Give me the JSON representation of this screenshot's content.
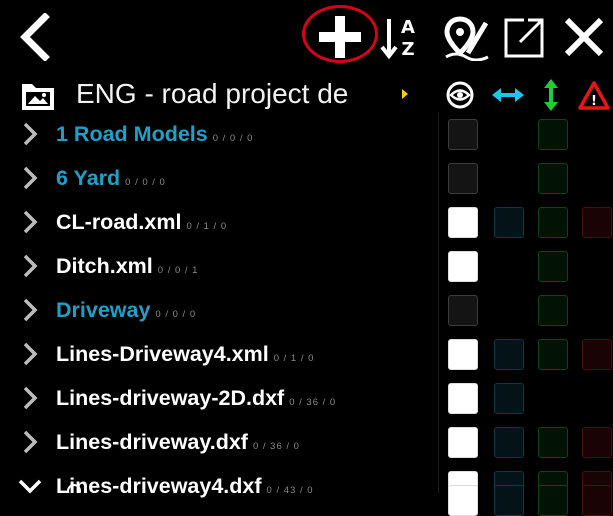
{
  "toolbar": {
    "back": "back-icon",
    "add": "plus-icon",
    "sort": "sort-az-icon",
    "map_edit": "map-pin-edit-icon",
    "open_external": "external-window-icon",
    "close": "close-icon",
    "highlight_color": "#d8001a"
  },
  "project": {
    "icon": "image-folder-icon",
    "title": "ENG - road project de"
  },
  "columns": {
    "visibility": "eye-icon",
    "horizontal": "horizontal-arrows-icon",
    "vertical": "vertical-arrows-icon",
    "warning": "warning-icon",
    "warning_text": "!",
    "cyan": "#18c6ee",
    "green": "#21cc36",
    "red": "#e8141a"
  },
  "rows": [
    {
      "label": "1 Road Models",
      "counts": "0 / 0 / 0",
      "color": "blue",
      "expanded": false,
      "checks": [
        "off",
        "none",
        "green",
        "none"
      ]
    },
    {
      "label": "6 Yard",
      "counts": "0 / 0 / 0",
      "color": "blue",
      "expanded": false,
      "checks": [
        "off",
        "none",
        "green",
        "none"
      ]
    },
    {
      "label": "CL-road.xml",
      "counts": "0 / 1 / 0",
      "color": "white",
      "expanded": false,
      "checks": [
        "on",
        "cyan",
        "green",
        "red"
      ]
    },
    {
      "label": "Ditch.xml",
      "counts": "0 / 0 / 1",
      "color": "white",
      "expanded": false,
      "checks": [
        "on",
        "none",
        "green",
        "none"
      ]
    },
    {
      "label": "Driveway",
      "counts": "0 / 0 / 0",
      "color": "blue",
      "expanded": false,
      "checks": [
        "off",
        "none",
        "green",
        "none"
      ]
    },
    {
      "label": "Lines-Driveway4.xml",
      "counts": "0 / 1 / 0",
      "color": "white",
      "expanded": false,
      "checks": [
        "on",
        "cyan",
        "green",
        "red"
      ]
    },
    {
      "label": "Lines-driveway-2D.dxf",
      "counts": "0 / 36 / 0",
      "color": "white",
      "expanded": false,
      "checks": [
        "on",
        "cyan",
        "none",
        "none"
      ]
    },
    {
      "label": "Lines-driveway.dxf",
      "counts": "0 / 36 / 0",
      "color": "white",
      "expanded": false,
      "checks": [
        "on",
        "cyan",
        "green",
        "red"
      ]
    },
    {
      "label": "Lines-driveway4.dxf",
      "counts": "0 / 43 / 0",
      "color": "white",
      "expanded": true,
      "checks": [
        "on",
        "cyan",
        "green",
        "red"
      ]
    }
  ]
}
